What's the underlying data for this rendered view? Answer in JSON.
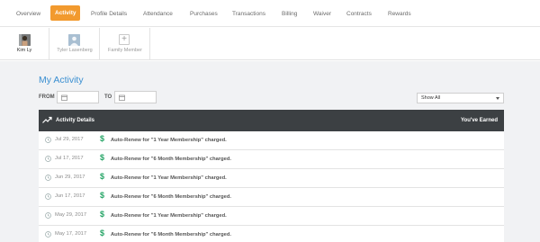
{
  "nav": {
    "tabs": [
      "Overview",
      "Activity",
      "Profile Details",
      "Attendance",
      "Purchases",
      "Transactions",
      "Billing",
      "Waiver",
      "Contracts",
      "Rewards"
    ],
    "active": "Activity"
  },
  "members": [
    {
      "name": "Kim Ly"
    },
    {
      "name": "Tyler Lasenberg"
    },
    {
      "name": "Family Member"
    }
  ],
  "activity": {
    "title": "My Activity",
    "from_label": "FROM",
    "to_label": "TO",
    "filter_value": "Show All",
    "table": {
      "col_left": "Activity Details",
      "col_right": "You've Earned",
      "rows": [
        {
          "date": "Jul 29, 2017",
          "text": "Auto-Renew for \"1 Year Membership\" charged."
        },
        {
          "date": "Jul 17, 2017",
          "text": "Auto-Renew for \"6 Month Membership\" charged."
        },
        {
          "date": "Jun 29, 2017",
          "text": "Auto-Renew for \"1 Year Membership\" charged."
        },
        {
          "date": "Jun 17, 2017",
          "text": "Auto-Renew for \"6 Month Membership\" charged."
        },
        {
          "date": "May 29, 2017",
          "text": "Auto-Renew for \"1 Year Membership\" charged."
        },
        {
          "date": "May 17, 2017",
          "text": "Auto-Renew for \"6 Month Membership\" charged."
        }
      ]
    }
  },
  "colors": {
    "accent": "#f29a2e",
    "title_blue": "#3a8fd1",
    "header_dark": "#3c4043",
    "dollar_green": "#27a567"
  }
}
